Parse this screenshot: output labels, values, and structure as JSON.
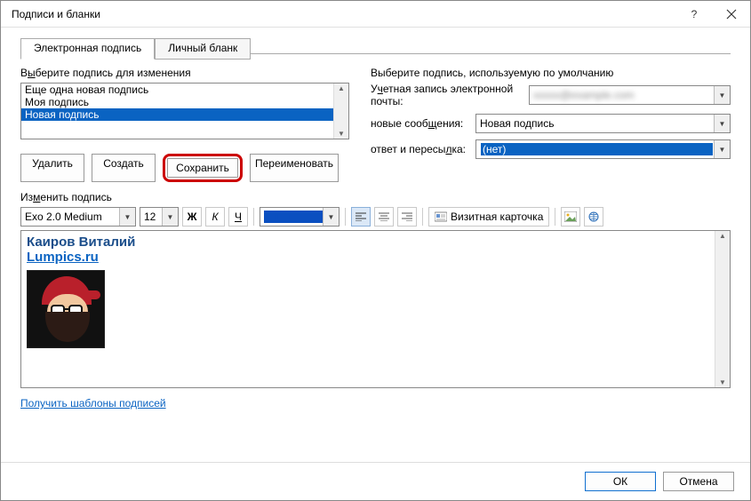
{
  "window": {
    "title": "Подписи и бланки"
  },
  "tabs": {
    "active": "Электронная подпись",
    "inactive": "Личный бланк"
  },
  "left": {
    "label_pre": "В",
    "label_ul": "ы",
    "label_post": "берите подпись для изменения",
    "items": [
      "Еще одна новая подпись",
      "Моя подпись",
      "Новая подпись"
    ],
    "selected_index": 2
  },
  "buttons": {
    "delete": "Удалить",
    "create_pre": "Создат",
    "create_ul": "ь",
    "save_pre": "Со",
    "save_ul": "х",
    "save_post": "ранить",
    "rename_pre": "",
    "rename_ul": "П",
    "rename_post": "ереименовать"
  },
  "right": {
    "heading": "Выберите подпись, используемую по умолчанию",
    "row1_pre": "У",
    "row1_ul": "ч",
    "row1_post": "етная запись электронной почты:",
    "row1_value": "xxxxx@example.com",
    "row2_pre": "новые сооб",
    "row2_ul": "щ",
    "row2_post": "ения:",
    "row2_value": "Новая подпись",
    "row3_pre": "ответ и пересы",
    "row3_ul": "л",
    "row3_post": "ка:",
    "row3_value": "(нет)"
  },
  "edit": {
    "label_pre": "Из",
    "label_ul": "м",
    "label_post": "енить подпись",
    "font": "Exo 2.0 Medium",
    "size": "12",
    "bold": "Ж",
    "italic": "К",
    "underline": "Ч",
    "vcard_pre": "",
    "vcard_ul": "В",
    "vcard_post": "изитная карточка",
    "line1": "Каиров Виталий",
    "line2": "Lumpics.ru"
  },
  "link": "Получить шаблоны подписей",
  "footer": {
    "ok": "ОК",
    "cancel": "Отмена"
  }
}
